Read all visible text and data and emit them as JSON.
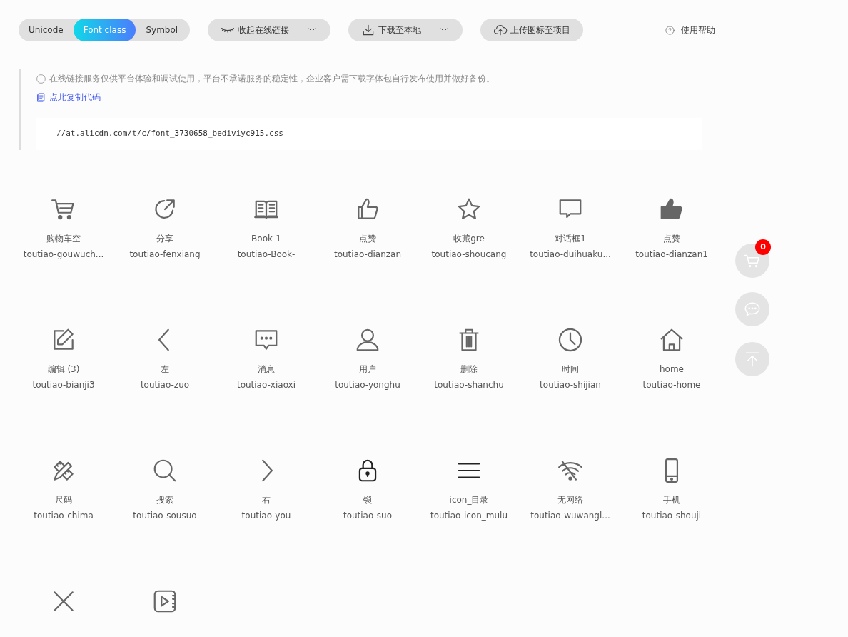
{
  "modes": [
    {
      "label": "Unicode",
      "selected": false
    },
    {
      "label": "Font class",
      "selected": true
    },
    {
      "label": "Symbol",
      "selected": false
    }
  ],
  "toolbar": [
    {
      "kind": "eye",
      "label": "收起在线链接",
      "dropdown": true
    },
    {
      "kind": "download",
      "label": "下载至本地",
      "dropdown": true
    },
    {
      "kind": "upload",
      "label": "上传图标至项目",
      "dropdown": false
    }
  ],
  "help": {
    "label": "使用帮助"
  },
  "notice": {
    "text": "在线链接服务仅供平台体验和调试使用，平台不承诺服务的稳定性，企业客户需下载字体包自行发布使用并做好备份。",
    "copy_link": "点此复制代码",
    "code": "//at.alicdn.com/t/c/font_3730658_bediviyc915.css"
  },
  "icons": [
    {
      "kind": "cart",
      "label": "购物车空",
      "code": "toutiao-gouwuch..."
    },
    {
      "kind": "share",
      "label": "分享",
      "code": "toutiao-fenxiang"
    },
    {
      "kind": "book",
      "label": "Book-1",
      "code": "toutiao-Book-"
    },
    {
      "kind": "thumb",
      "label": "点赞",
      "code": "toutiao-dianzan"
    },
    {
      "kind": "star",
      "label": "收藏gre",
      "code": "toutiao-shoucang"
    },
    {
      "kind": "bubble",
      "label": "对话框1",
      "code": "toutiao-duihuaku..."
    },
    {
      "kind": "thumb-filled",
      "label": "点赞",
      "code": "toutiao-dianzan1"
    },
    {
      "kind": "edit",
      "label": "编辑 (3)",
      "code": "toutiao-bianji3"
    },
    {
      "kind": "left",
      "label": "左",
      "code": "toutiao-zuo"
    },
    {
      "kind": "message",
      "label": "消息",
      "code": "toutiao-xiaoxi"
    },
    {
      "kind": "user",
      "label": "用户",
      "code": "toutiao-yonghu"
    },
    {
      "kind": "trash",
      "label": "删除",
      "code": "toutiao-shanchu"
    },
    {
      "kind": "clock",
      "label": "时间",
      "code": "toutiao-shijian"
    },
    {
      "kind": "home",
      "label": "home",
      "code": "toutiao-home"
    },
    {
      "kind": "ruler",
      "label": "尺码",
      "code": "toutiao-chima"
    },
    {
      "kind": "search",
      "label": "搜索",
      "code": "toutiao-sousuo"
    },
    {
      "kind": "right",
      "label": "右",
      "code": "toutiao-you"
    },
    {
      "kind": "lock",
      "label": "锁",
      "code": "toutiao-suo"
    },
    {
      "kind": "menu",
      "label": "icon_目录",
      "code": "toutiao-icon_mulu"
    },
    {
      "kind": "nowifi",
      "label": "无网络",
      "code": "toutiao-wuwangl..."
    },
    {
      "kind": "phone",
      "label": "手机",
      "code": "toutiao-shouji"
    },
    {
      "kind": "close"
    },
    {
      "kind": "video"
    }
  ],
  "floating": [
    {
      "kind": "cart",
      "badge": "0"
    },
    {
      "kind": "chat"
    },
    {
      "kind": "top"
    }
  ]
}
